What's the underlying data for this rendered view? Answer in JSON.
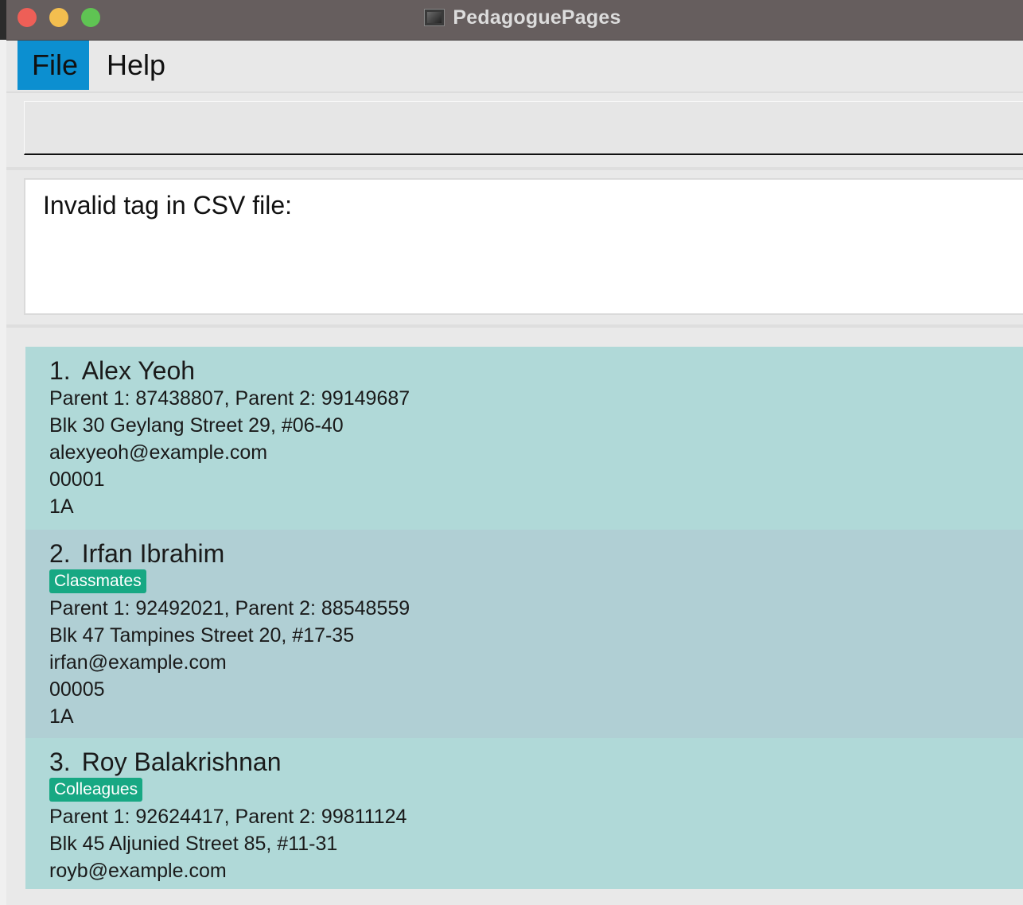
{
  "window": {
    "title": "PedagoguePages"
  },
  "menu": {
    "file": "File",
    "help": "Help"
  },
  "command": {
    "value": ""
  },
  "result": {
    "text": "Invalid tag in CSV file:"
  },
  "contacts": [
    {
      "index": "1.",
      "name": "Alex Yeoh",
      "tags": [],
      "phones": "Parent 1: 87438807, Parent 2: 99149687",
      "address": "Blk 30 Geylang Street 29, #06-40",
      "email": "alexyeoh@example.com",
      "id": "00001",
      "class": "1A"
    },
    {
      "index": "2.",
      "name": "Irfan Ibrahim",
      "tags": [
        "Classmates"
      ],
      "phones": "Parent 1: 92492021, Parent 2: 88548559",
      "address": "Blk 47 Tampines Street 20, #17-35",
      "email": "irfan@example.com",
      "id": "00005",
      "class": "1A"
    },
    {
      "index": "3.",
      "name": "Roy Balakrishnan",
      "tags": [
        "Colleagues"
      ],
      "phones": "Parent 1: 92624417, Parent 2: 99811124",
      "address": "Blk 45 Aljunied Street 85, #11-31",
      "email": "royb@example.com"
    }
  ],
  "colors": {
    "titlebar": "#665e5e",
    "menu_active": "#0c8fd0",
    "card_odd": "#b0d9d8",
    "card_even": "#b0cfd4",
    "tag": "#17a883"
  }
}
